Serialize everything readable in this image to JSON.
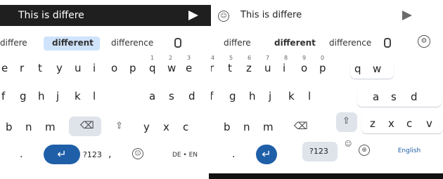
{
  "left": {
    "input_text": "This is differe",
    "suggestions": [
      "differe",
      "different",
      "difference"
    ],
    "row1": [
      "e",
      "r",
      "t",
      "y",
      "u",
      "i",
      "o",
      "p"
    ],
    "row2": [
      "f",
      "g",
      "h",
      "j",
      "k",
      "l"
    ],
    "row3": [
      "b",
      "n",
      "m"
    ],
    "key_num": "?123",
    "comma": ",",
    "period": "."
  },
  "middle": {
    "nums": [
      "1",
      "2",
      "3",
      "4",
      "5",
      "6",
      "7",
      "8",
      "9",
      "0"
    ],
    "row1": [
      "q",
      "w",
      "e",
      "r",
      "t",
      "z",
      "u",
      "i",
      "o",
      "p"
    ],
    "row2": [
      "a",
      "s",
      "d",
      "f",
      "g",
      "h",
      "j",
      "k",
      "l"
    ],
    "row3": [
      "y",
      "x",
      "c",
      "v",
      "b",
      "n",
      "m"
    ],
    "space_label": "DE • EN",
    "comma": ",",
    "period": "."
  },
  "right": {
    "input_text": "This is differe",
    "suggestions": [
      "differe",
      "different",
      "difference"
    ],
    "nums": [
      "1",
      "2",
      "3",
      "4",
      "5",
      "6",
      "7",
      "8",
      "9",
      "0"
    ],
    "row1": [
      "q",
      "w",
      "e",
      "r",
      "t",
      "z",
      "u",
      "i",
      "o",
      "p"
    ],
    "row2": [
      "a",
      "s",
      "d",
      "f",
      "g",
      "h",
      "j",
      "k",
      "l"
    ],
    "row3": [
      "y",
      "x",
      "c",
      "v",
      "b",
      "n",
      "m"
    ],
    "key_num": "?123",
    "space_label": "English"
  },
  "far_right": {
    "row1": [
      "q",
      "w"
    ],
    "row2": [
      "a",
      "s",
      "d"
    ],
    "row3": [
      "z",
      "x",
      "c",
      "v"
    ],
    "key_num": "?123",
    "space_label": "English"
  }
}
